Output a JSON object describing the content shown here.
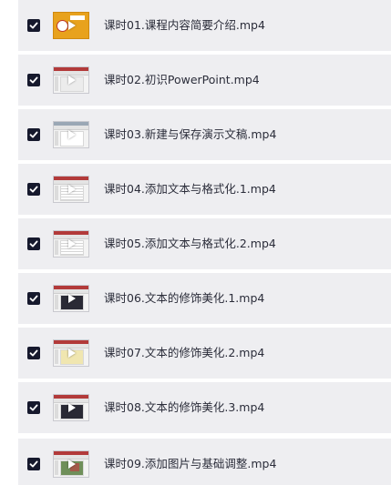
{
  "files": [
    {
      "name": "课时01.课程内容简要介绍.mp4",
      "checked": true,
      "thumb": "orange"
    },
    {
      "name": "课时02.初识PowerPoint.mp4",
      "checked": true,
      "thumb": "gray"
    },
    {
      "name": "课时03.新建与保存演示文稿.mp4",
      "checked": true,
      "thumb": "light"
    },
    {
      "name": "课时04.添加文本与格式化.1.mp4",
      "checked": true,
      "thumb": "doc"
    },
    {
      "name": "课时05.添加文本与格式化.2.mp4",
      "checked": true,
      "thumb": "doc"
    },
    {
      "name": "课时06.文本的修饰美化.1.mp4",
      "checked": true,
      "thumb": "dark"
    },
    {
      "name": "课时07.文本的修饰美化.2.mp4",
      "checked": true,
      "thumb": "yellow"
    },
    {
      "name": "课时08.文本的修饰美化.3.mp4",
      "checked": true,
      "thumb": "dark"
    },
    {
      "name": "课时09.添加图片与基础调整.mp4",
      "checked": true,
      "thumb": "photo"
    }
  ],
  "colors": {
    "row_background": "#eeeef1",
    "checkbox_fill": "#16192d",
    "text": "#2b2d3a"
  },
  "icons": {
    "checkbox": "checkmark-icon",
    "thumbnail_overlay": "play-icon"
  }
}
